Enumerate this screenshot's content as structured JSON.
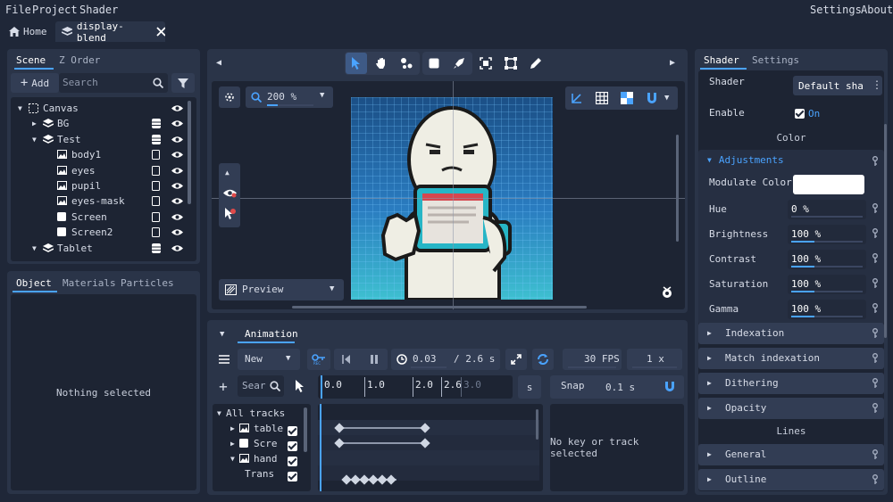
{
  "menu": {
    "file": "File",
    "project": "Project",
    "shader": "Shader",
    "settings": "Settings",
    "about": "About"
  },
  "tabs": {
    "home": "Home",
    "doc": "display-blend"
  },
  "scene": {
    "tab_scene": "Scene",
    "tab_zorder": "Z Order",
    "add": "Add",
    "search_placeholder": "Search",
    "nodes": [
      {
        "label": "Canvas",
        "indent": 0,
        "arrow": "down",
        "icon": "canvas-icon",
        "type": ""
      },
      {
        "label": "BG",
        "indent": 1,
        "arrow": "right",
        "icon": "layers-icon",
        "type": "db"
      },
      {
        "label": "Test",
        "indent": 1,
        "arrow": "down",
        "icon": "layers-icon",
        "type": "db"
      },
      {
        "label": "body1",
        "indent": 2,
        "arrow": "",
        "icon": "image-icon",
        "type": "doc"
      },
      {
        "label": "eyes",
        "indent": 2,
        "arrow": "",
        "icon": "image-icon",
        "type": "doc"
      },
      {
        "label": "pupil",
        "indent": 2,
        "arrow": "",
        "icon": "image-icon",
        "type": "doc"
      },
      {
        "label": "eyes-mask",
        "indent": 2,
        "arrow": "",
        "icon": "image-icon",
        "type": "doc"
      },
      {
        "label": "Screen",
        "indent": 2,
        "arrow": "",
        "icon": "square-icon",
        "type": "doc"
      },
      {
        "label": "Screen2",
        "indent": 2,
        "arrow": "",
        "icon": "square-icon",
        "type": "doc"
      },
      {
        "label": "Tablet",
        "indent": 1,
        "arrow": "down",
        "icon": "layers-icon",
        "type": "db"
      }
    ]
  },
  "object": {
    "tab_object": "Object",
    "tab_materials": "Materials",
    "tab_particles": "Particles",
    "empty": "Nothing selected"
  },
  "viewport": {
    "zoom": "200 %",
    "preview": "Preview"
  },
  "animation": {
    "tab": "Animation",
    "anim_name": "New",
    "time": "0.03",
    "duration": "/ 2.6 s",
    "fps": "30 FPS",
    "speed": "1 x",
    "search_placeholder": "Sear",
    "seconds": "s",
    "snap": "Snap",
    "snap_value": "0.1 s",
    "ruler": [
      "0.0",
      "1.0",
      "2.0",
      "2.6",
      "3.0"
    ],
    "empty": "No key or track selected",
    "tracks_root": "All tracks",
    "tracks": [
      {
        "label": "table",
        "icon": "image-icon",
        "arrow": "right",
        "indent": 1
      },
      {
        "label": "Scre",
        "icon": "square-icon",
        "arrow": "right",
        "indent": 1
      },
      {
        "label": "hand",
        "icon": "image-icon",
        "arrow": "down",
        "indent": 1
      },
      {
        "label": "Trans",
        "icon": "",
        "arrow": "",
        "indent": 2
      }
    ]
  },
  "shader_panel": {
    "tab_shader": "Shader",
    "tab_settings": "Settings",
    "shader_label": "Shader",
    "shader_value": "Default sha",
    "enable_label": "Enable",
    "enable_value": "On",
    "color_heading": "Color",
    "adjustments": "Adjustments",
    "modulate_label": "Modulate Color",
    "modulate_color": "#ffffff",
    "props": [
      {
        "label": "Hue",
        "value": "0 %",
        "level": 0.0
      },
      {
        "label": "Brightness",
        "value": "100 %",
        "level": 0.33
      },
      {
        "label": "Contrast",
        "value": "100 %",
        "level": 0.33
      },
      {
        "label": "Saturation",
        "value": "100 %",
        "level": 0.33
      },
      {
        "label": "Gamma",
        "value": "100 %",
        "level": 0.33
      }
    ],
    "sections": [
      "Indexation",
      "Match indexation",
      "Dithering",
      "Opacity"
    ],
    "lines_heading": "Lines",
    "sections2": [
      "General",
      "Outline"
    ]
  },
  "colors": {
    "accent": "#4aa3ff",
    "panel": "#2a3448",
    "bg": "#1f2738"
  }
}
